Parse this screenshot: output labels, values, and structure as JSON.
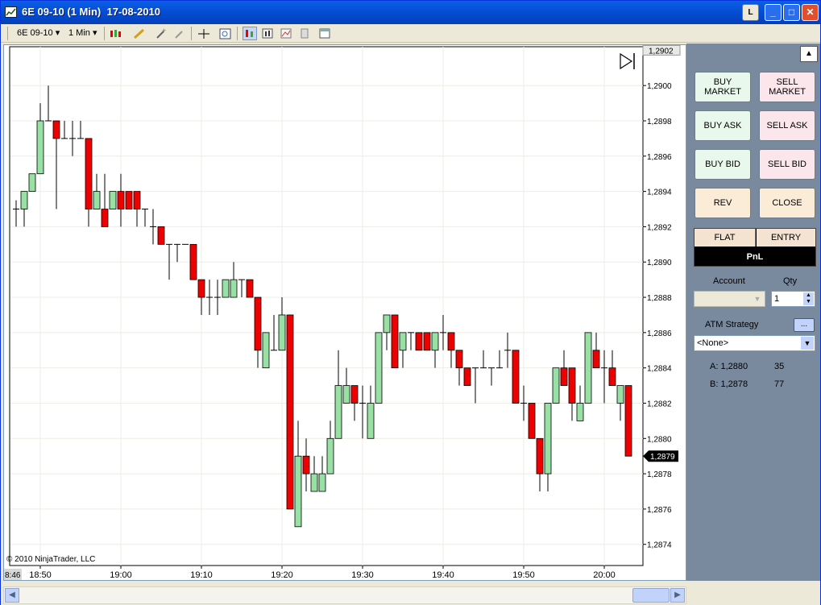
{
  "window": {
    "title": "6E 09-10 (1 Min)  17-08-2010",
    "link_button": "L"
  },
  "toolbar": {
    "instrument": "6E 09-10",
    "interval": "1 Min"
  },
  "chart": {
    "copyright": "© 2010 NinjaTrader, LLC",
    "current_price_label": "1,2879",
    "top_price_label": "1,2902",
    "time_start_label": "8:46",
    "play_icon": "skip-to-end-icon"
  },
  "panel": {
    "buy_market": "BUY MARKET",
    "sell_market": "SELL MARKET",
    "buy_ask": "BUY ASK",
    "sell_ask": "SELL ASK",
    "buy_bid": "BUY BID",
    "sell_bid": "SELL BID",
    "rev": "REV",
    "close": "CLOSE",
    "flat": "FLAT",
    "entry": "ENTRY",
    "pnl": "PnL",
    "account_label": "Account",
    "qty_label": "Qty",
    "qty_value": "1",
    "atm_label": "ATM Strategy",
    "atm_button": "...",
    "atm_value": "<None>",
    "ask": "A: 1,2880",
    "ask_size": "35",
    "bid": "B: 1,2878",
    "bid_size": "77"
  },
  "colors": {
    "up": "#98e0a4",
    "down": "#ee0000",
    "panel_bg": "#7a8a9e"
  },
  "chart_data": {
    "type": "candlestick",
    "y_ticks": [
      "1,2900",
      "1,2898",
      "1,2896",
      "1,2894",
      "1,2892",
      "1,2890",
      "1,2888",
      "1,2886",
      "1,2884",
      "1,2882",
      "1,2880",
      "1,2878",
      "1,2876",
      "1,2874"
    ],
    "x_ticks": [
      "18:50",
      "19:00",
      "19:10",
      "19:20",
      "19:30",
      "19:40",
      "19:50",
      "20:00"
    ],
    "ylim": [
      1.28728,
      1.29022
    ],
    "first_bar_time": "18:47",
    "ohlc": [
      [
        1.2893,
        1.28935,
        1.2892,
        1.2893
      ],
      [
        1.2893,
        1.2894,
        1.2892,
        1.2894
      ],
      [
        1.2894,
        1.2895,
        1.2894,
        1.2895
      ],
      [
        1.2895,
        1.2899,
        1.2895,
        1.2898
      ],
      [
        1.2898,
        1.29,
        1.2898,
        1.2898
      ],
      [
        1.2898,
        1.2898,
        1.2893,
        1.2897
      ],
      [
        1.2897,
        1.2898,
        1.2897,
        1.2897
      ],
      [
        1.2897,
        1.2898,
        1.2896,
        1.2897
      ],
      [
        1.2897,
        1.2898,
        1.2897,
        1.2897
      ],
      [
        1.2897,
        1.2897,
        1.2892,
        1.2893
      ],
      [
        1.2893,
        1.2895,
        1.2893,
        1.2894
      ],
      [
        1.2893,
        1.2895,
        1.2892,
        1.2892
      ],
      [
        1.2893,
        1.2894,
        1.2893,
        1.2894
      ],
      [
        1.2894,
        1.2895,
        1.2892,
        1.2893
      ],
      [
        1.2894,
        1.2894,
        1.2893,
        1.2893
      ],
      [
        1.2894,
        1.2894,
        1.2892,
        1.2893
      ],
      [
        1.2893,
        1.2893,
        1.2892,
        1.2893
      ],
      [
        1.2892,
        1.2893,
        1.2891,
        1.2892
      ],
      [
        1.2892,
        1.2892,
        1.2891,
        1.2891
      ],
      [
        1.2891,
        1.2891,
        1.2889,
        1.2891
      ],
      [
        1.2891,
        1.2891,
        1.289,
        1.2891
      ],
      [
        1.2891,
        1.2891,
        1.2891,
        1.2891
      ],
      [
        1.2891,
        1.2891,
        1.2889,
        1.2889
      ],
      [
        1.2889,
        1.2889,
        1.2887,
        1.2888
      ],
      [
        1.2888,
        1.2889,
        1.2887,
        1.2888
      ],
      [
        1.2888,
        1.2889,
        1.2887,
        1.2888
      ],
      [
        1.2888,
        1.2889,
        1.2888,
        1.2889
      ],
      [
        1.2888,
        1.289,
        1.2888,
        1.2889
      ],
      [
        1.2889,
        1.2889,
        1.2888,
        1.2889
      ],
      [
        1.2889,
        1.2889,
        1.2888,
        1.2888
      ],
      [
        1.2888,
        1.2888,
        1.2884,
        1.2885
      ],
      [
        1.2884,
        1.2886,
        1.2884,
        1.2886
      ],
      [
        1.2885,
        1.2887,
        1.2885,
        1.2885
      ],
      [
        1.2885,
        1.2888,
        1.2885,
        1.2887
      ],
      [
        1.2887,
        1.2887,
        1.2876,
        1.2876
      ],
      [
        1.2875,
        1.2881,
        1.2875,
        1.2879
      ],
      [
        1.2879,
        1.288,
        1.2877,
        1.2878
      ],
      [
        1.2877,
        1.2879,
        1.2877,
        1.2878
      ],
      [
        1.2877,
        1.2879,
        1.2877,
        1.2878
      ],
      [
        1.2878,
        1.2881,
        1.2878,
        1.288
      ],
      [
        1.288,
        1.2885,
        1.288,
        1.2883
      ],
      [
        1.2882,
        1.2884,
        1.2882,
        1.2883
      ],
      [
        1.2883,
        1.2883,
        1.2881,
        1.2882
      ],
      [
        1.2882,
        1.2883,
        1.288,
        1.2882
      ],
      [
        1.288,
        1.2883,
        1.288,
        1.2882
      ],
      [
        1.2882,
        1.2886,
        1.2882,
        1.2886
      ],
      [
        1.2886,
        1.2887,
        1.2885,
        1.2887
      ],
      [
        1.2887,
        1.2887,
        1.2884,
        1.2884
      ],
      [
        1.2885,
        1.2886,
        1.2884,
        1.2886
      ],
      [
        1.2886,
        1.2886,
        1.2885,
        1.2886
      ],
      [
        1.2886,
        1.2886,
        1.2885,
        1.2885
      ],
      [
        1.2886,
        1.2886,
        1.2885,
        1.2885
      ],
      [
        1.2885,
        1.2886,
        1.2884,
        1.2886
      ],
      [
        1.2886,
        1.2887,
        1.2885,
        1.2886
      ],
      [
        1.2886,
        1.2886,
        1.2884,
        1.2885
      ],
      [
        1.2885,
        1.2885,
        1.2883,
        1.2884
      ],
      [
        1.2884,
        1.2884,
        1.2883,
        1.2883
      ],
      [
        1.2884,
        1.2884,
        1.2882,
        1.2884
      ],
      [
        1.2884,
        1.2885,
        1.2884,
        1.2884
      ],
      [
        1.2884,
        1.2884,
        1.2883,
        1.2884
      ],
      [
        1.2884,
        1.2885,
        1.2884,
        1.2884
      ],
      [
        1.2885,
        1.2886,
        1.2884,
        1.2885
      ],
      [
        1.2885,
        1.2885,
        1.2882,
        1.2882
      ],
      [
        1.2882,
        1.2883,
        1.2881,
        1.2882
      ],
      [
        1.2882,
        1.2882,
        1.288,
        1.288
      ],
      [
        1.288,
        1.288,
        1.2877,
        1.2878
      ],
      [
        1.2878,
        1.2882,
        1.2877,
        1.2882
      ],
      [
        1.2882,
        1.2884,
        1.2882,
        1.2884
      ],
      [
        1.2884,
        1.2885,
        1.2883,
        1.2883
      ],
      [
        1.2884,
        1.2884,
        1.2881,
        1.2882
      ],
      [
        1.2881,
        1.2883,
        1.2881,
        1.2882
      ],
      [
        1.2882,
        1.2886,
        1.2882,
        1.2886
      ],
      [
        1.2885,
        1.2886,
        1.2884,
        1.2884
      ],
      [
        1.2884,
        1.2885,
        1.2882,
        1.2884
      ],
      [
        1.2884,
        1.2885,
        1.2883,
        1.2883
      ],
      [
        1.2882,
        1.2883,
        1.2881,
        1.2883
      ],
      [
        1.2883,
        1.2883,
        1.2879,
        1.2879
      ]
    ]
  }
}
